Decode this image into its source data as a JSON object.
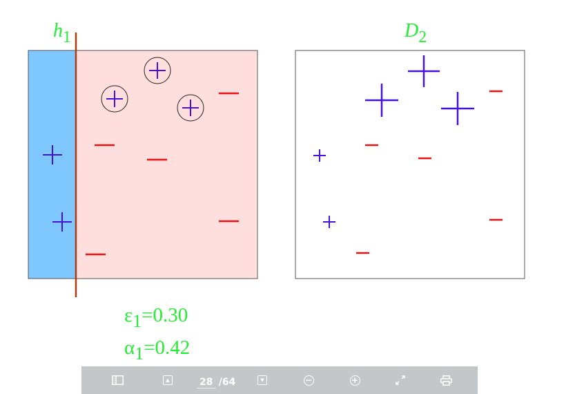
{
  "slide": {
    "hypothesis_label": {
      "base": "h",
      "sub": "1"
    },
    "dataset_label": {
      "base": "D",
      "sub": "2"
    },
    "epsilon": {
      "symbol": "ε",
      "sub": "1",
      "value": "=0.30"
    },
    "alpha": {
      "symbol": "α",
      "sub": "1",
      "value": "=0.42"
    },
    "plus_glyph": "+",
    "colors": {
      "label_green": "#22ee33",
      "positive_purple": "#4411dd",
      "negative_red": "#ee1111",
      "region_blue": "#7fc8ff",
      "region_pink": "#ffdede",
      "boundary_line": "#b03a0a"
    }
  },
  "toolbar": {
    "current_page": "28",
    "page_separator": "/",
    "total_pages": "64",
    "icons": [
      "sidebar-icon",
      "prev-page-icon",
      "next-page-icon",
      "zoom-out-icon",
      "zoom-in-icon",
      "fullscreen-icon",
      "print-icon"
    ]
  }
}
